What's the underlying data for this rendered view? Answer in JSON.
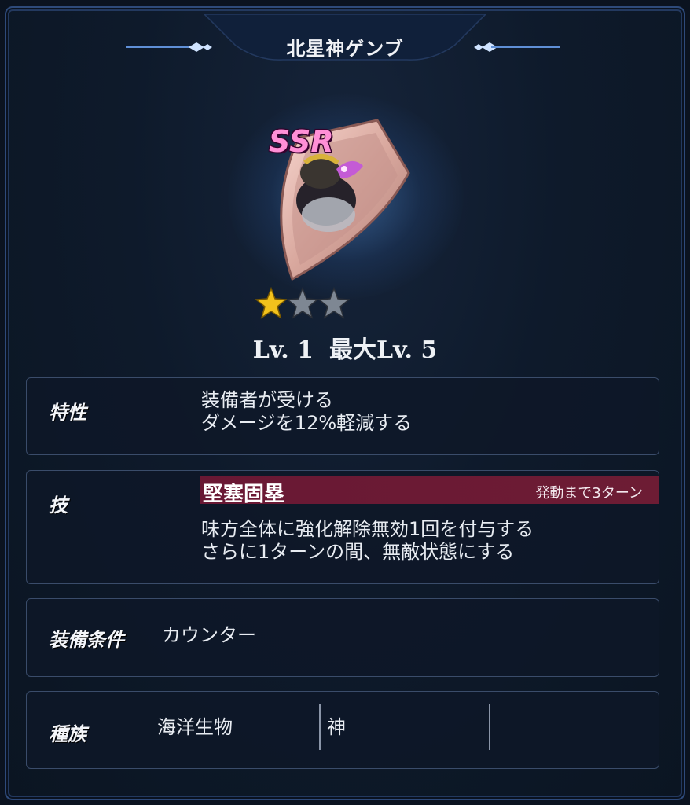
{
  "header": {
    "title": "北星神ゲンブ"
  },
  "item": {
    "rarity": "SSR",
    "stars_filled": 1,
    "stars_total": 3
  },
  "level": {
    "current": "Lv. 1",
    "max": "最大Lv. 5"
  },
  "trait": {
    "label": "特性",
    "text": "装備者が受ける\nダメージを12%軽減する"
  },
  "skill": {
    "label": "技",
    "name": "堅塞固塁",
    "cooldown": "発動まで3ターン",
    "text": "味方全体に強化解除無効1回を付与する\nさらに1ターンの間、無敵状態にする"
  },
  "equip_condition": {
    "label": "装備条件",
    "value": "カウンター"
  },
  "race": {
    "label": "種族",
    "values": [
      "海洋生物",
      "神",
      ""
    ]
  },
  "colors": {
    "skill_bar": "#6d1c34",
    "frame_border": "#2e4a7a",
    "rarity_pink": "#ff8fd6",
    "star_gold": "#f2c21c"
  }
}
